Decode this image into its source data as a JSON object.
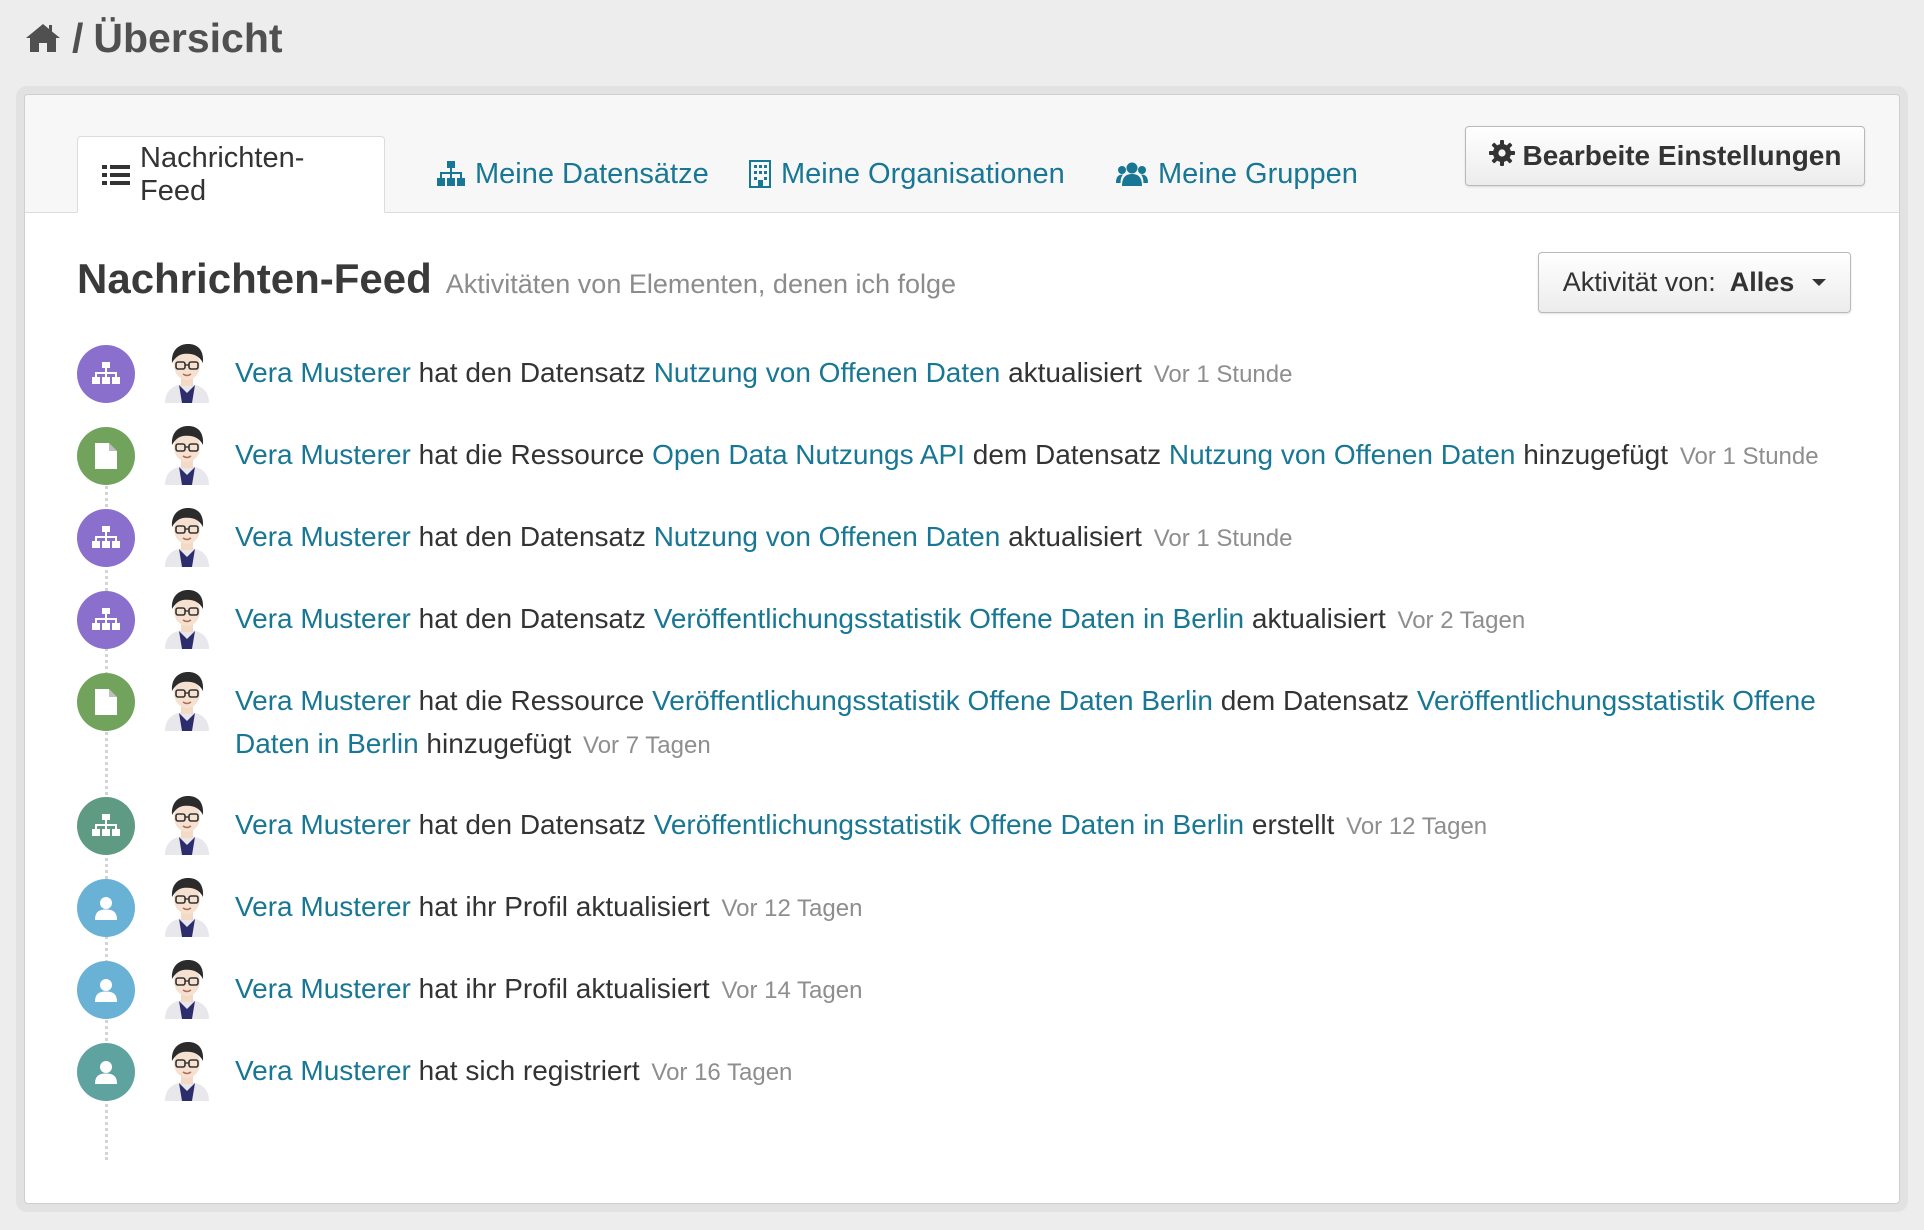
{
  "breadcrumb": {
    "icon": "home-icon",
    "separator": "/",
    "current": "Übersicht"
  },
  "tabs": [
    {
      "label": "Nachrichten-Feed",
      "icon": "list-icon",
      "active": true
    },
    {
      "label": "Meine Datensätze",
      "icon": "sitemap-icon",
      "active": false
    },
    {
      "label": "Meine Organisationen",
      "icon": "building-icon",
      "active": false
    },
    {
      "label": "Meine Gruppen",
      "icon": "group-icon",
      "active": false
    }
  ],
  "settings_button": {
    "label": "Bearbeite Einstellungen",
    "icon": "gear-icon"
  },
  "feed": {
    "title": "Nachrichten-Feed",
    "subtitle": "Aktivitäten von Elementen, denen ich folge",
    "filter": {
      "label": "Aktivität von:",
      "value": "Alles"
    }
  },
  "colors": {
    "link": "#187794",
    "dataset_update": "#8a6fcd",
    "resource_add": "#72a35d",
    "dataset_create": "#5e9b82",
    "profile_update": "#6ab1d6",
    "user_register": "#5fa3a0"
  },
  "activities": [
    {
      "type": "dataset-update",
      "parts": [
        {
          "t": "Vera Musterer",
          "link": true
        },
        {
          "t": " hat den Datensatz "
        },
        {
          "t": "Nutzung von Offenen Daten",
          "link": true
        },
        {
          "t": " aktualisiert"
        }
      ],
      "date": "Vor 1 Stunde"
    },
    {
      "type": "resource-add",
      "parts": [
        {
          "t": "Vera Musterer",
          "link": true
        },
        {
          "t": " hat die Ressource "
        },
        {
          "t": "Open Data Nutzungs API",
          "link": true
        },
        {
          "t": " dem Datensatz "
        },
        {
          "t": "Nutzung von Offenen Daten",
          "link": true
        },
        {
          "t": " hinzugefügt"
        }
      ],
      "date": "Vor 1 Stunde"
    },
    {
      "type": "dataset-update",
      "parts": [
        {
          "t": "Vera Musterer",
          "link": true
        },
        {
          "t": " hat den Datensatz "
        },
        {
          "t": "Nutzung von Offenen Daten",
          "link": true
        },
        {
          "t": " aktualisiert"
        }
      ],
      "date": "Vor 1 Stunde"
    },
    {
      "type": "dataset-update",
      "parts": [
        {
          "t": "Vera Musterer",
          "link": true
        },
        {
          "t": " hat den Datensatz "
        },
        {
          "t": "Veröffentlichungsstatistik Offene Daten in Berlin",
          "link": true
        },
        {
          "t": " aktualisiert"
        }
      ],
      "date": "Vor 2 Tagen"
    },
    {
      "type": "resource-add",
      "parts": [
        {
          "t": "Vera Musterer",
          "link": true
        },
        {
          "t": " hat die Ressource "
        },
        {
          "t": "Veröffentlichungsstatistik Offene Daten Berlin",
          "link": true
        },
        {
          "t": " dem Datensatz "
        },
        {
          "t": "Veröffentlichungsstatistik Offene Daten in Berlin",
          "link": true
        },
        {
          "t": " hinzugefügt"
        }
      ],
      "date": "Vor 7 Tagen"
    },
    {
      "type": "dataset-create",
      "parts": [
        {
          "t": "Vera Musterer",
          "link": true
        },
        {
          "t": " hat den Datensatz "
        },
        {
          "t": "Veröffentlichungsstatistik Offene Daten in Berlin",
          "link": true
        },
        {
          "t": " erstellt"
        }
      ],
      "date": "Vor 12 Tagen"
    },
    {
      "type": "profile-update",
      "parts": [
        {
          "t": "Vera Musterer",
          "link": true
        },
        {
          "t": " hat ihr Profil aktualisiert"
        }
      ],
      "date": "Vor 12 Tagen"
    },
    {
      "type": "profile-update",
      "parts": [
        {
          "t": "Vera Musterer",
          "link": true
        },
        {
          "t": " hat ihr Profil aktualisiert"
        }
      ],
      "date": "Vor 14 Tagen"
    },
    {
      "type": "user-register",
      "parts": [
        {
          "t": "Vera Musterer",
          "link": true
        },
        {
          "t": " hat sich registriert"
        }
      ],
      "date": "Vor 16 Tagen"
    }
  ]
}
